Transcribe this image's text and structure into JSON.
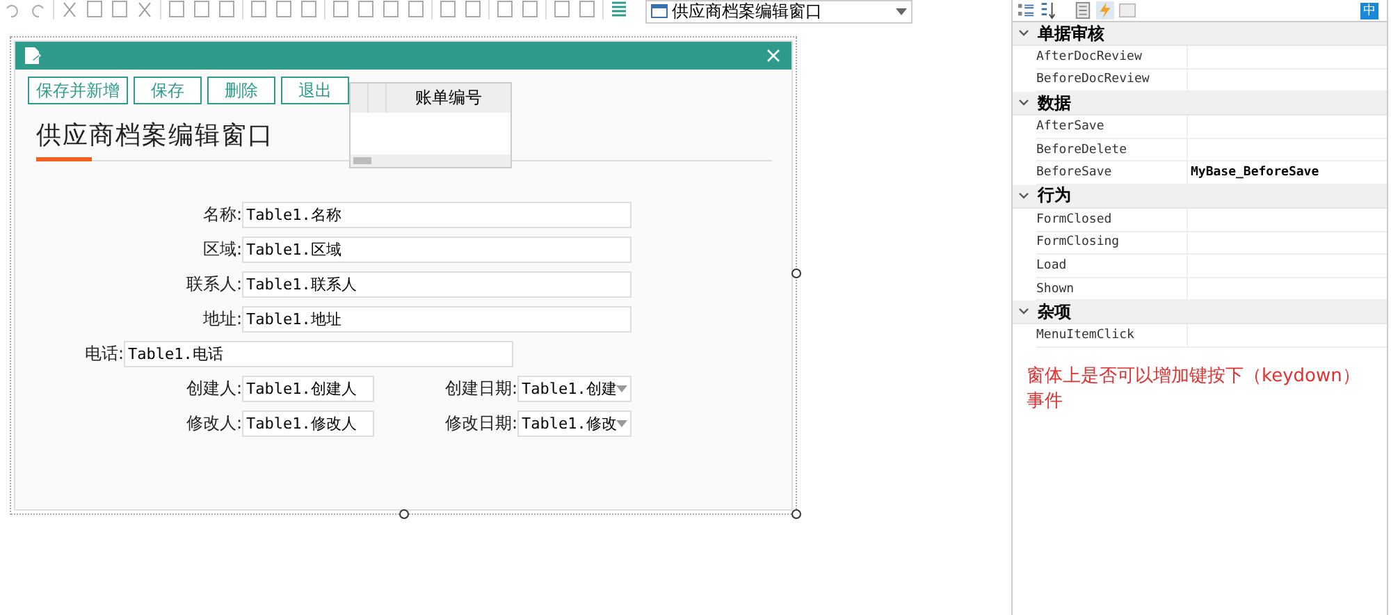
{
  "toolbar": {
    "form_selector": "供应商档案编辑窗口"
  },
  "form": {
    "buttons": [
      "保存并新增",
      "保存",
      "删除",
      "退出"
    ],
    "heading": "供应商档案编辑窗口",
    "grid": {
      "columns": [
        "",
        "",
        "账单编号"
      ]
    },
    "rows": [
      {
        "kind": "field",
        "label": "名称:",
        "value": "Table1.名称"
      },
      {
        "kind": "field",
        "label": "区域:",
        "value": "Table1.区域"
      },
      {
        "kind": "field",
        "label": "联系人:",
        "value": "Table1.联系人"
      },
      {
        "kind": "field",
        "label": "地址:",
        "value": "Table1.地址"
      },
      {
        "kind": "shifted",
        "label": "电话:",
        "value": "Table1.电话"
      },
      {
        "kind": "pair",
        "items": [
          {
            "label": "创建人:",
            "value": "Table1.创建人",
            "dropdown": false
          },
          {
            "label": "创建日期:",
            "value": "Table1.创建",
            "dropdown": true
          }
        ]
      },
      {
        "kind": "pair",
        "items": [
          {
            "label": "修改人:",
            "value": "Table1.修改人",
            "dropdown": false
          },
          {
            "label": "修改日期:",
            "value": "Table1.修改",
            "dropdown": true
          }
        ]
      }
    ]
  },
  "properties": {
    "ime_badge": "中",
    "categories": [
      {
        "name": "单据审核",
        "expanded": true,
        "items": [
          {
            "name": "AfterDocReview"
          },
          {
            "name": "BeforeDocReview"
          }
        ]
      },
      {
        "name": "数据",
        "expanded": true,
        "items": [
          {
            "name": "AfterSave"
          },
          {
            "name": "BeforeDelete"
          },
          {
            "name": "BeforeSave",
            "value": "MyBase_BeforeSave"
          }
        ]
      },
      {
        "name": "行为",
        "expanded": true,
        "items": [
          {
            "name": "FormClosed"
          },
          {
            "name": "FormClosing"
          },
          {
            "name": "Load"
          },
          {
            "name": "Shown"
          }
        ]
      },
      {
        "name": "杂项",
        "expanded": true,
        "items": [
          {
            "name": "MenuItemClick"
          }
        ]
      }
    ]
  },
  "note": "窗体上是否可以增加键按下（keydown）事件"
}
